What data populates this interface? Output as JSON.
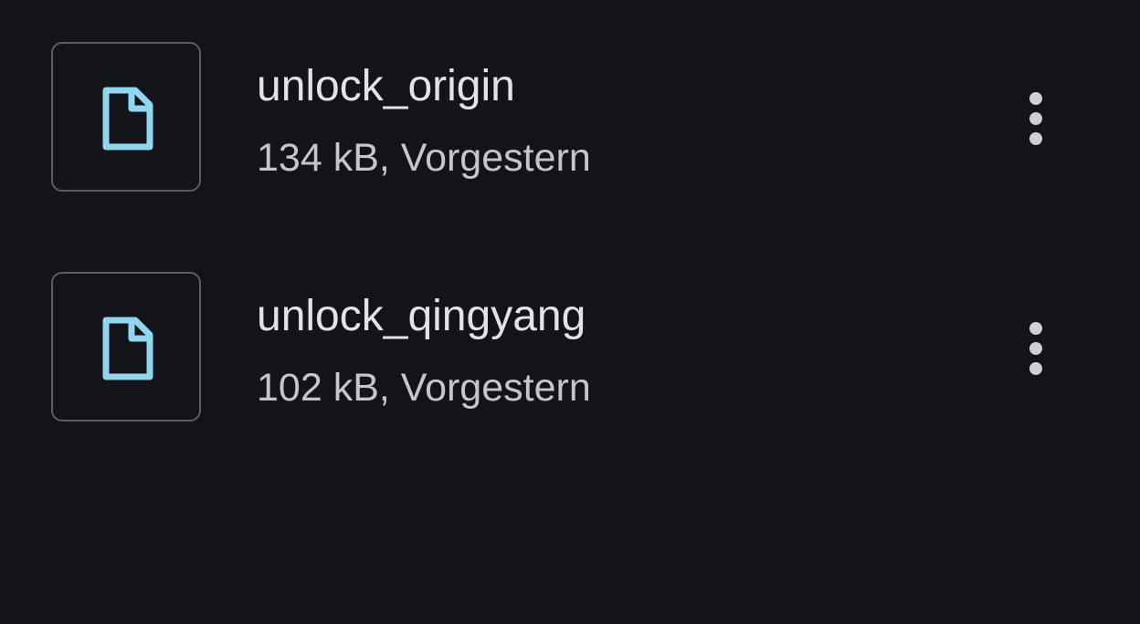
{
  "colors": {
    "background": "#131419",
    "file_icon_accent": "#8fd6ee",
    "thumbnail_border": "#5c5e64",
    "primary_text": "#e3e3e6",
    "secondary_text": "#c5c6cb"
  },
  "files": [
    {
      "icon": "file-icon",
      "name": "unlock_origin",
      "meta": "134 kB, Vorgestern",
      "menu_icon": "more-vert-icon"
    },
    {
      "icon": "file-icon",
      "name": "unlock_qingyang",
      "meta": "102 kB, Vorgestern",
      "menu_icon": "more-vert-icon"
    }
  ]
}
